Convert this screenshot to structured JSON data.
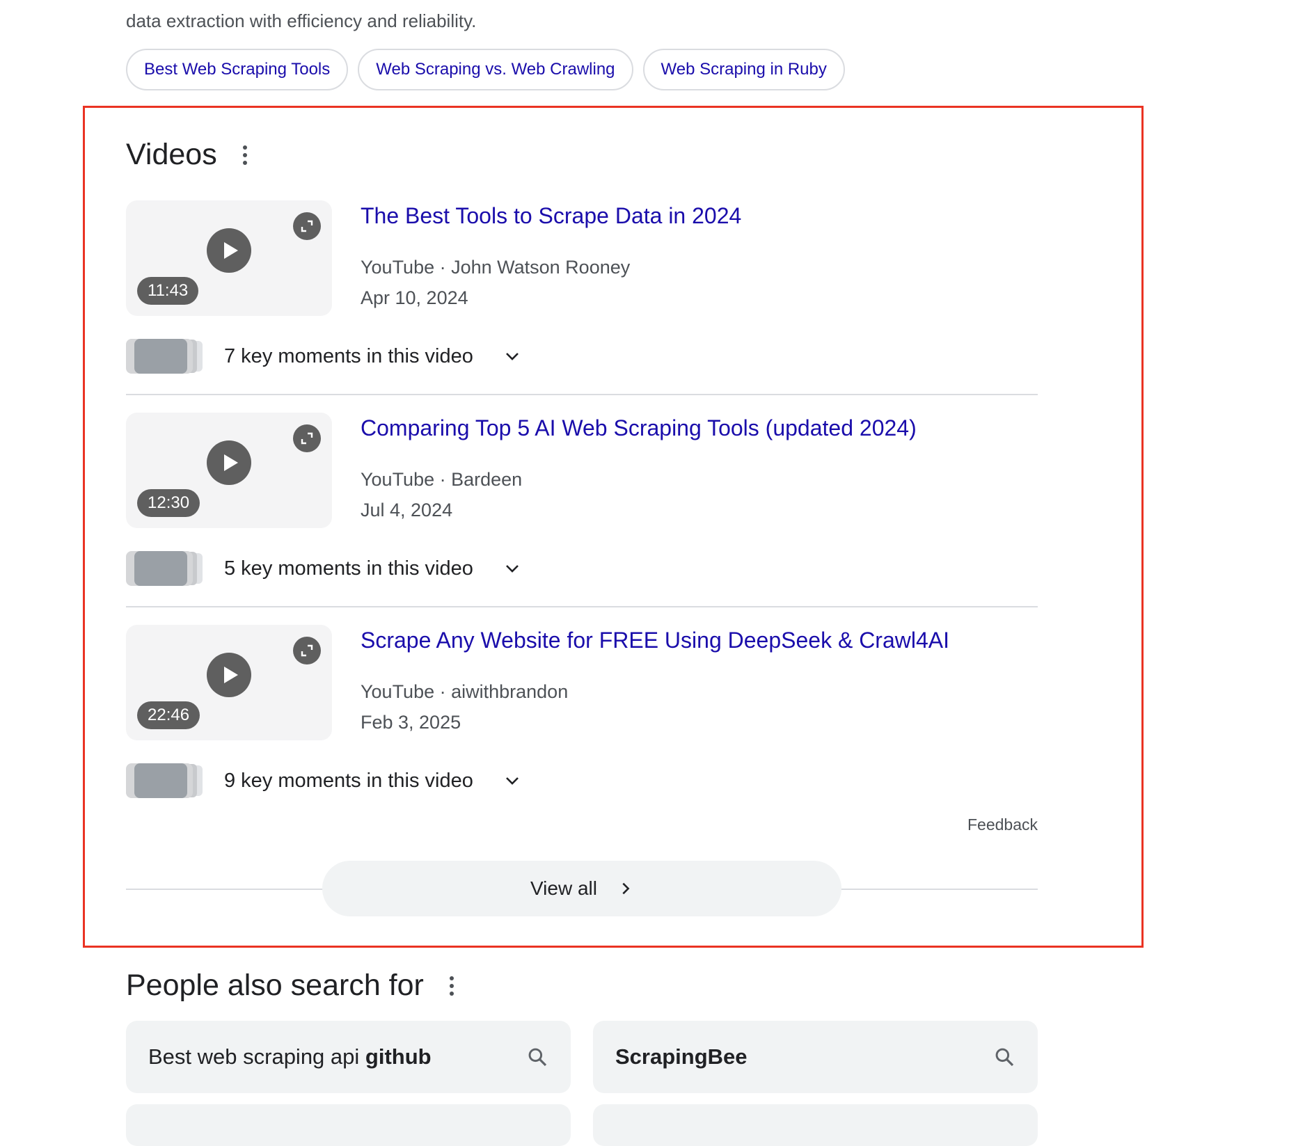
{
  "intro": {
    "text": "data extraction with efficiency and reliability."
  },
  "chips": [
    {
      "label": "Best Web Scraping Tools"
    },
    {
      "label": "Web Scraping vs. Web Crawling"
    },
    {
      "label": "Web Scraping in Ruby"
    }
  ],
  "videos_section": {
    "title": "Videos",
    "items": [
      {
        "duration": "11:43",
        "title": "The Best Tools to Scrape Data in 2024",
        "source": "YouTube · John Watson Rooney",
        "date": "Apr 10, 2024",
        "moments": "7 key moments in this video"
      },
      {
        "duration": "12:30",
        "title": "Comparing Top 5 AI Web Scraping Tools (updated 2024)",
        "source": "YouTube · Bardeen",
        "date": "Jul 4, 2024",
        "moments": "5 key moments in this video"
      },
      {
        "duration": "22:46",
        "title": "Scrape Any Website for FREE Using DeepSeek & Crawl4AI",
        "source": "YouTube · aiwithbrandon",
        "date": "Feb 3, 2025",
        "moments": "9 key moments in this video"
      }
    ],
    "feedback": "Feedback",
    "view_all": "View all"
  },
  "people_also_search": {
    "title": "People also search for",
    "items": [
      {
        "prefix": "Best web scraping api ",
        "bold": "github"
      },
      {
        "prefix": "",
        "bold": "ScrapingBee"
      }
    ]
  },
  "colors": {
    "link": "#1a0dab",
    "highlight_border": "#ea3323",
    "muted_text": "#4d5156"
  },
  "icons": [
    "more-vert-icon",
    "play-icon",
    "expand-icon",
    "chevron-down-icon",
    "chevron-right-icon",
    "search-icon"
  ]
}
